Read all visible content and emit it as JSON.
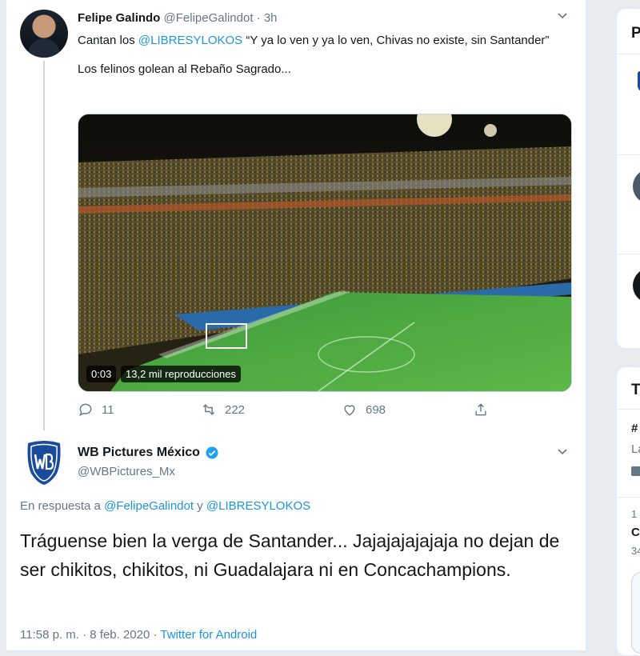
{
  "tweet1": {
    "name": "Felipe Galindo",
    "handle": "@FelipeGalindot",
    "separator": "·",
    "time": "3h",
    "text_prefix": "Cantan los ",
    "mention": "@LIBRESYLOKOS",
    "text_quote": " “Y ya lo ven y ya lo ven, Chivas no existe, sin Santander”",
    "text_line2": "Los felinos golean al Rebaño Sagrado...",
    "video_time": "0:03",
    "video_views": "13,2 mil reproducciones",
    "replies": "11",
    "retweets": "222",
    "likes": "698"
  },
  "tweet2": {
    "name": "WB Pictures México",
    "handle": "@WBPictures_Mx",
    "reply_prefix": "En respuesta a ",
    "reply_mention1": "@FelipeGalindot",
    "reply_joiner": " y ",
    "reply_mention2": "@LIBRESYLOKOS",
    "text": "Tráguense bien la verga de Santander... Jajajajajajaja no dejan de ser chikitos, chikitos, ni Guadalajara ni en Concachampions.",
    "timestamp": "11:58 p. m. · 8 feb. 2020",
    "meta_separator": " · ",
    "source": "Twitter for Android"
  },
  "sidebar": {
    "card1_title": "P",
    "card2_title": "T",
    "trend_hash": "#",
    "trend_a": "La",
    "trend_num": "1",
    "trend_b": "C",
    "trend_c": "34"
  },
  "colors": {
    "link": "#1b95e0",
    "muted": "#657786",
    "verified": "#1da1f2",
    "wb_blue": "#1a4a9c"
  },
  "icons": [
    "chevron-down-icon",
    "reply-icon",
    "retweet-icon",
    "like-icon",
    "share-icon",
    "verified-icon"
  ]
}
